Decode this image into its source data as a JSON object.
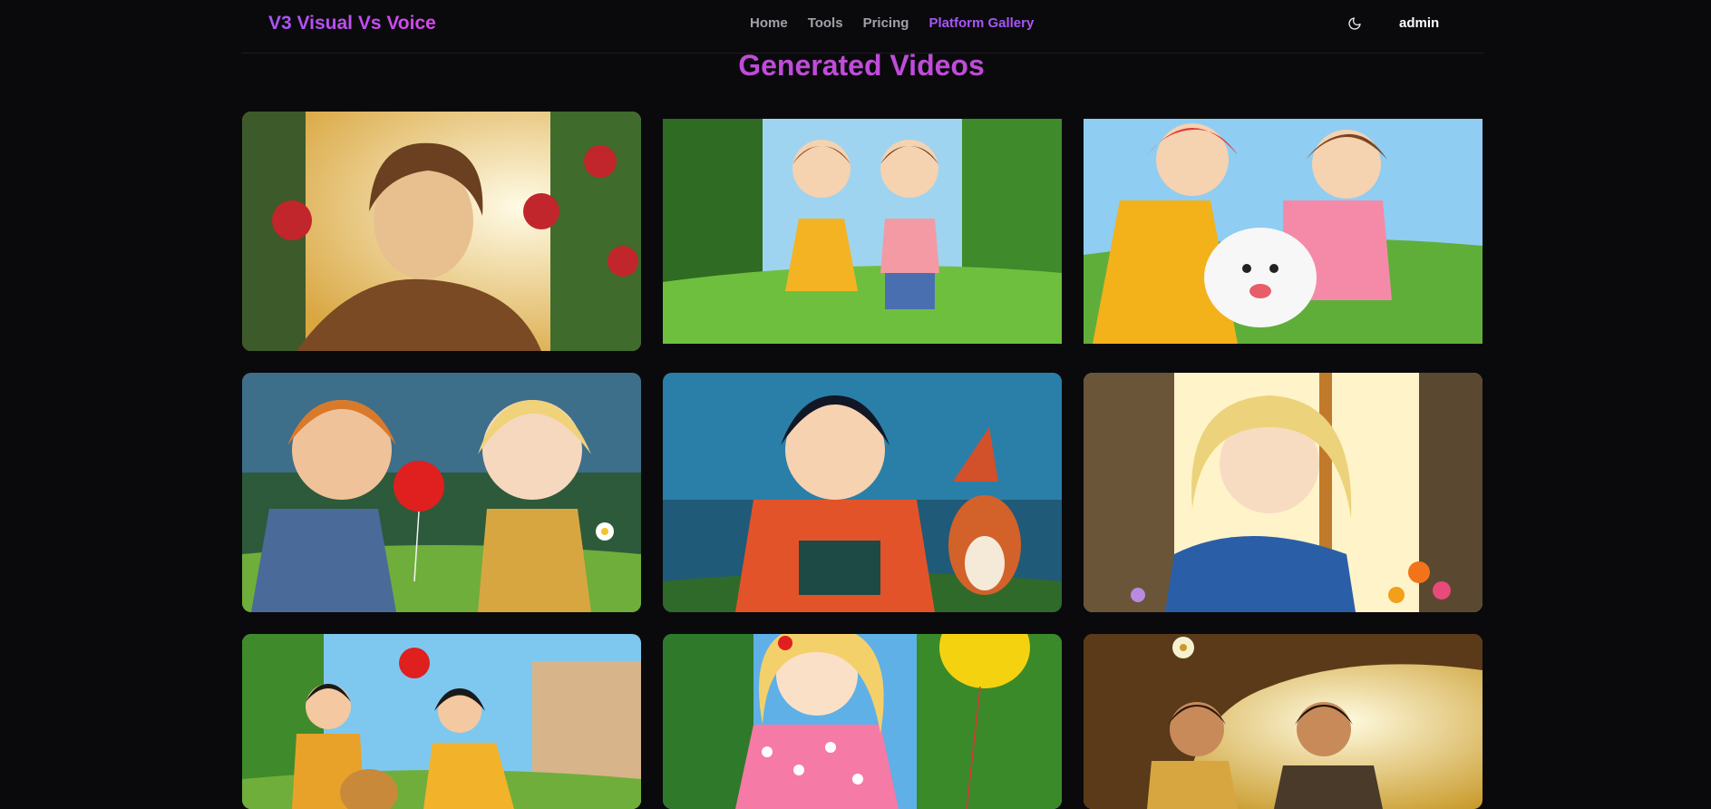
{
  "nav": {
    "brand": "V3 Visual Vs Voice",
    "links": [
      {
        "label": "Home"
      },
      {
        "label": "Tools"
      },
      {
        "label": "Pricing"
      },
      {
        "label": "Platform Gallery",
        "active": true
      }
    ],
    "theme_icon": "moon-icon",
    "user": "admin"
  },
  "page": {
    "title": "Generated Videos"
  },
  "colors": {
    "accent": "#a855f7",
    "title": "#c04bd9",
    "background": "#0a0a0c"
  },
  "videos": [
    {
      "scene": "boy-with-roses"
    },
    {
      "scene": "two-girls-running-in-park"
    },
    {
      "scene": "two-girls-with-white-dog"
    },
    {
      "scene": "boy-and-girl-with-red-balloon"
    },
    {
      "scene": "boy-with-book-and-fox"
    },
    {
      "scene": "blonde-girl-by-window"
    },
    {
      "scene": "children-running-with-dog"
    },
    {
      "scene": "girl-with-yellow-balloon"
    },
    {
      "scene": "children-under-tree-with-dandelions"
    }
  ]
}
